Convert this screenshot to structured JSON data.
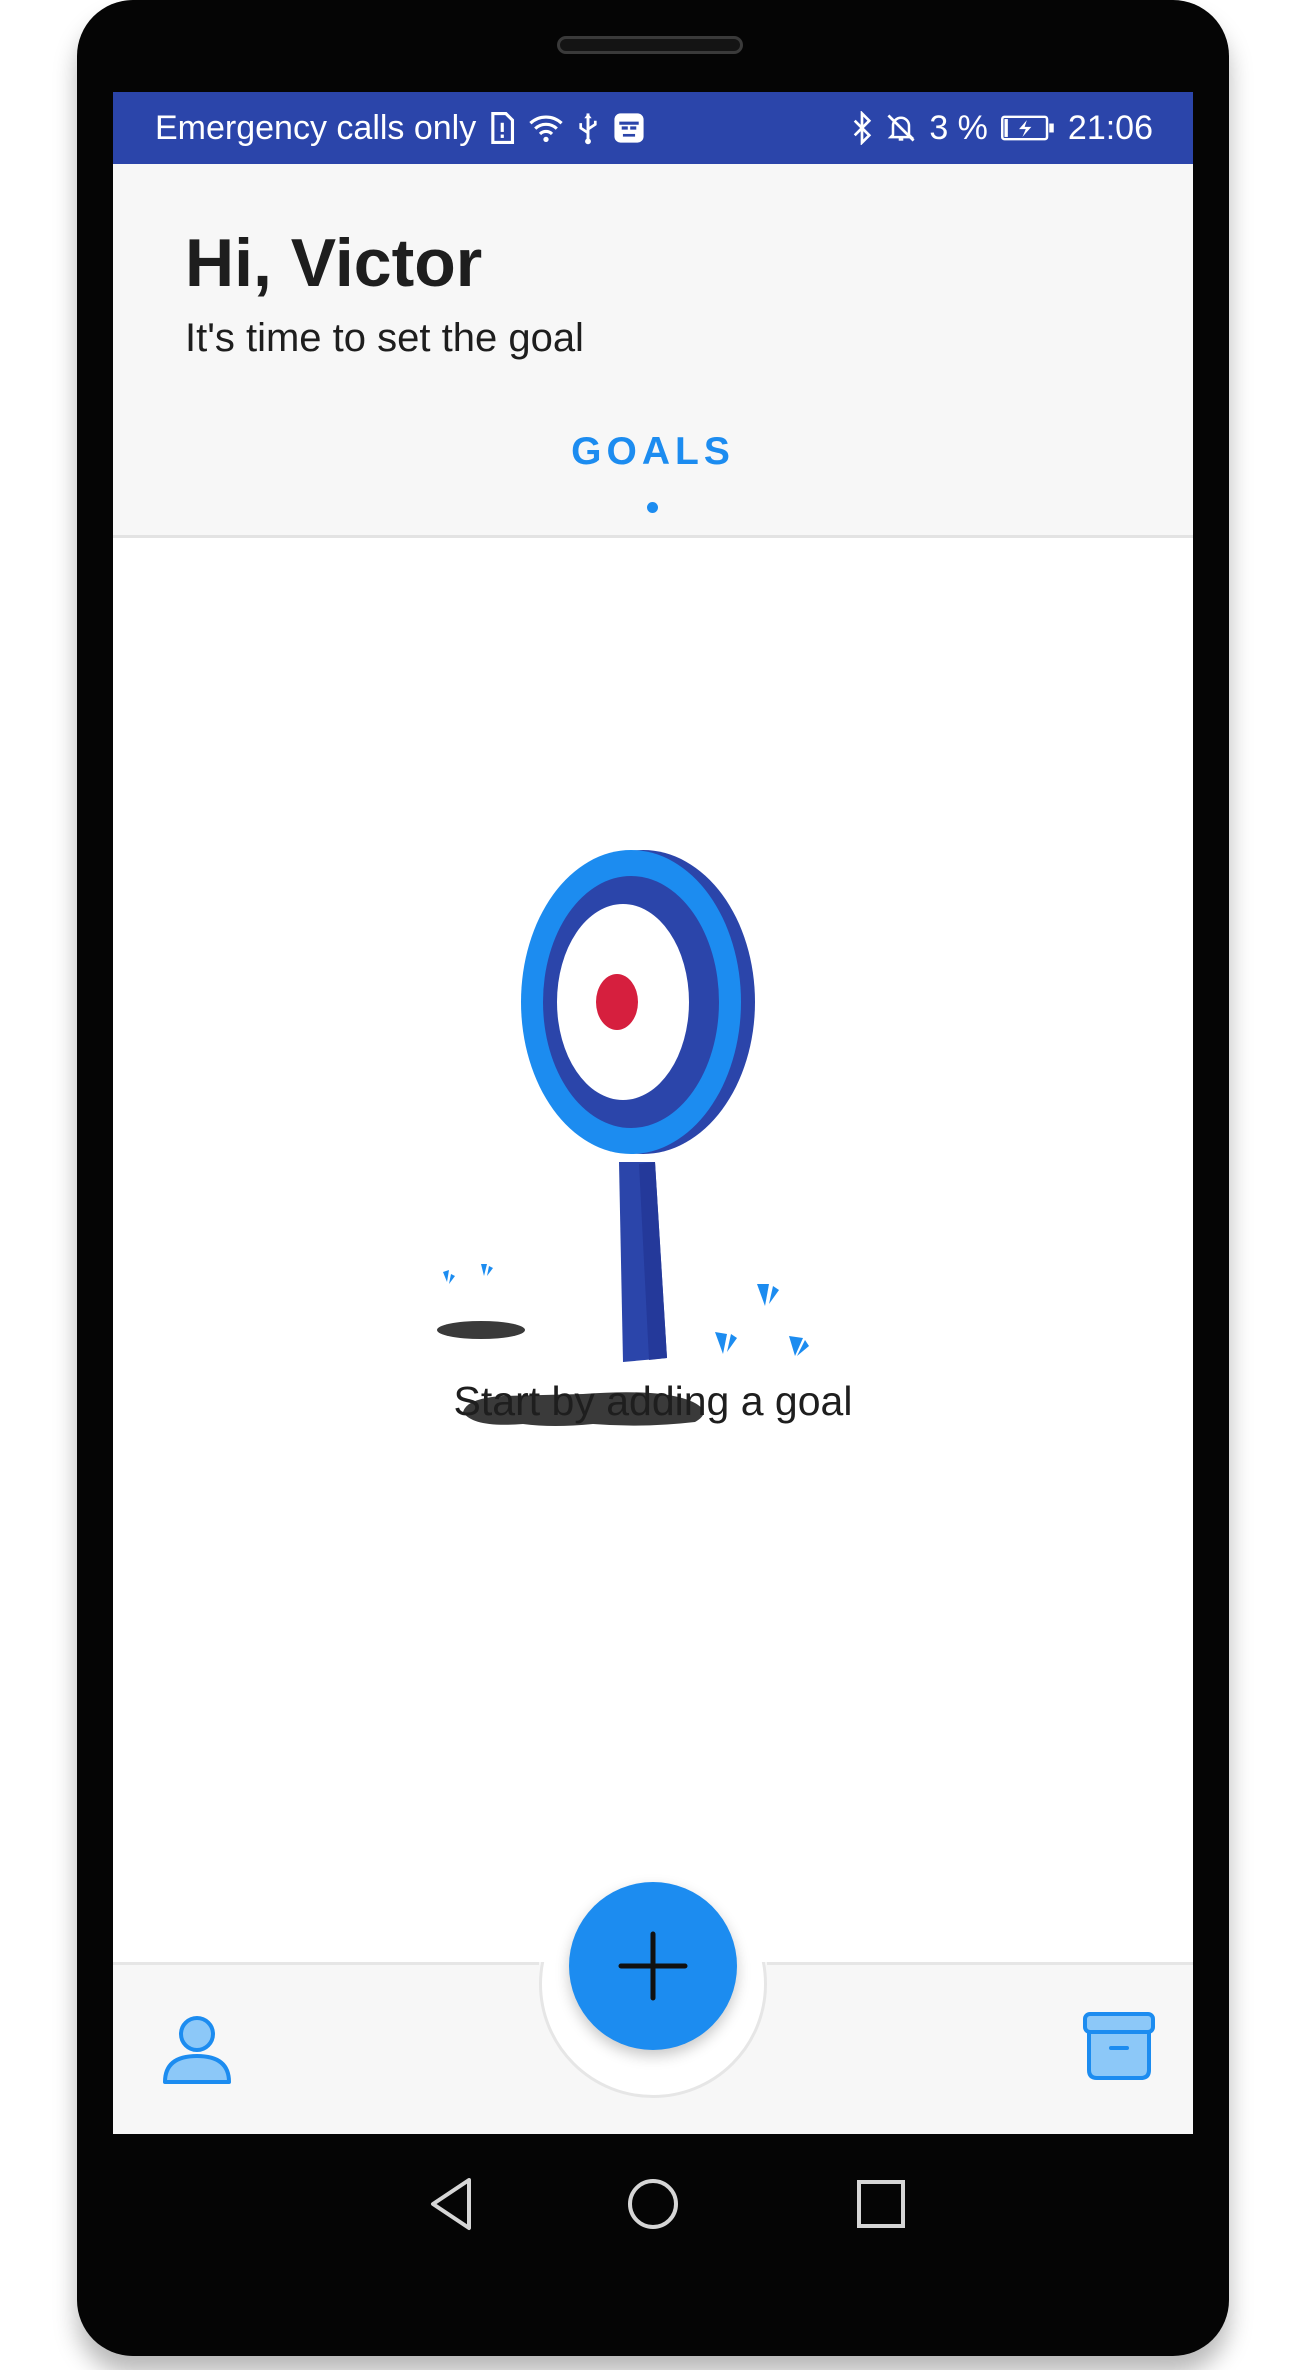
{
  "status_bar": {
    "carrier_text": "Emergency calls only",
    "battery_text": "3 %",
    "time": "21:06",
    "left_icons": [
      "sim-icon",
      "wifi-icon",
      "usb-icon",
      "notification-app-icon"
    ],
    "right_icons": [
      "bluetooth-icon",
      "mute-icon",
      "battery-charging-icon"
    ]
  },
  "header": {
    "greeting": "Hi, Victor",
    "subtitle": "It's time to set the goal"
  },
  "tabs": [
    {
      "label": "GOALS",
      "active": true
    }
  ],
  "empty_state": {
    "illustration": "target-on-stand-illustration",
    "message": "Start by adding a goal"
  },
  "bottom_bar": {
    "left_icon": "profile-icon",
    "fab_icon": "plus-icon",
    "right_icon": "archive-icon"
  },
  "system_nav": [
    "back-icon",
    "home-icon",
    "recents-icon"
  ],
  "colors": {
    "status_bar": "#2b45aa",
    "accent": "#1c8cf0",
    "target_dark": "#2b45aa",
    "target_center": "#d61f3e",
    "ground": "#3a3a3a"
  }
}
